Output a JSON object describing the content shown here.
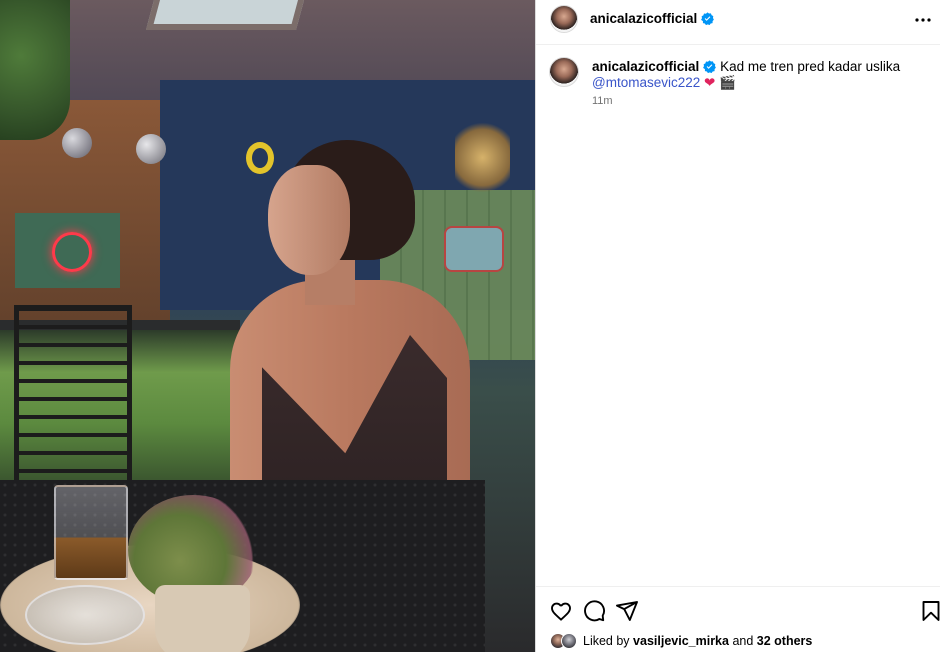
{
  "post": {
    "username": "anicalazicofficial",
    "caption_text": "Kad me tren pred kadar uslika",
    "mention": "@mtomasevic222",
    "emoji_heart": "❤",
    "emoji_clapper": "🎬",
    "time_ago": "11m"
  },
  "likes": {
    "prefix": "Liked by",
    "liker": "vasiljevic_mirka",
    "middle": "and",
    "others": "32 others"
  },
  "colors": {
    "verified": "#0095f6",
    "mention": "#3a55c9",
    "muted": "#737373"
  },
  "icons": [
    "verified-badge-icon",
    "more-options-icon",
    "heart-icon",
    "comment-icon",
    "share-icon",
    "bookmark-icon"
  ]
}
